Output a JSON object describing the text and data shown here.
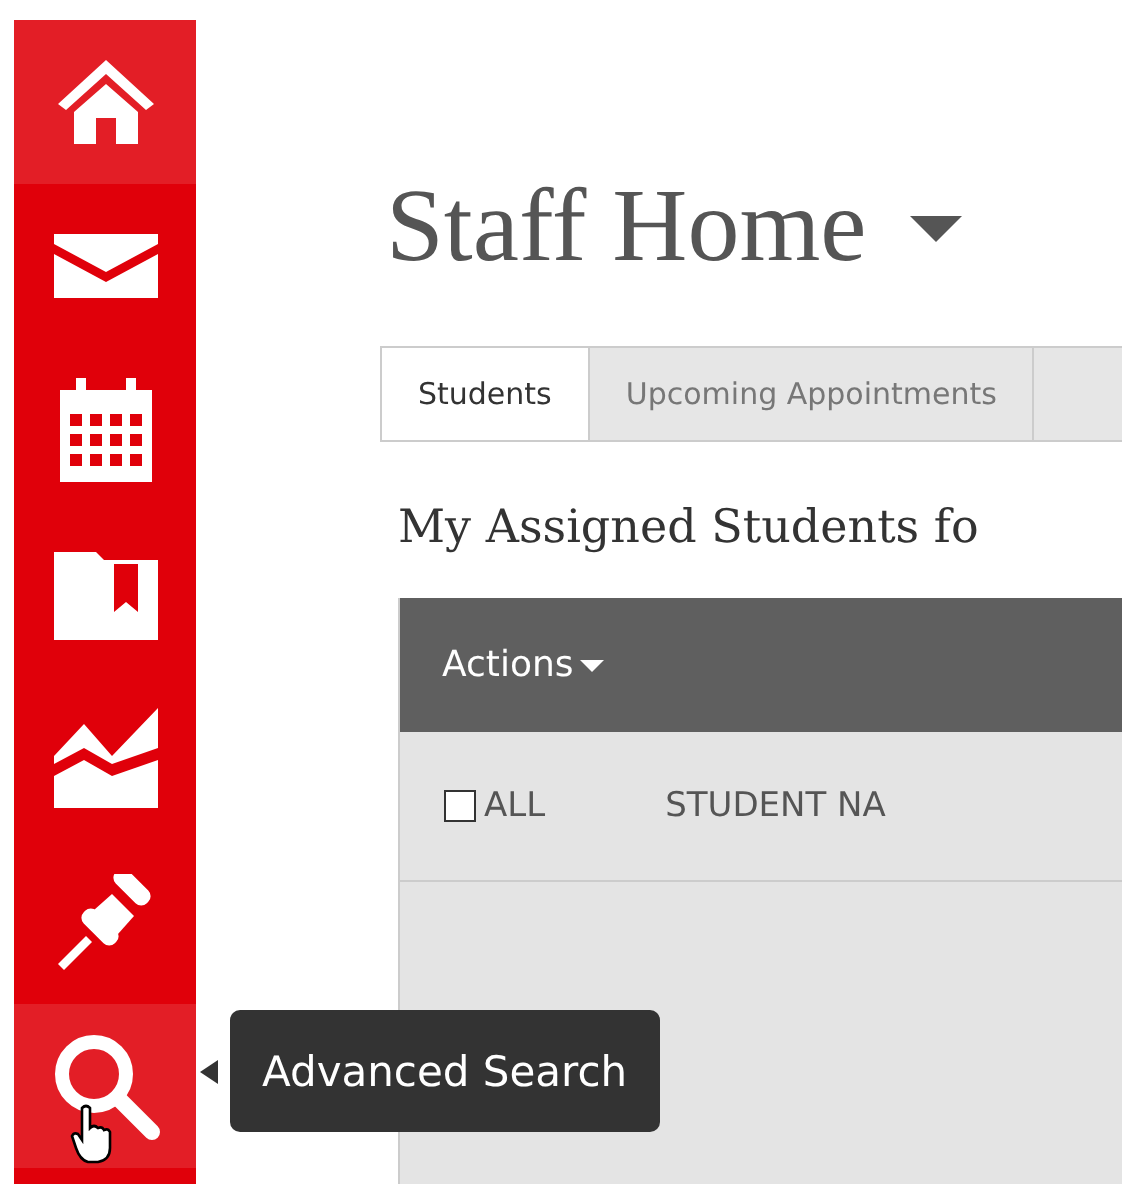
{
  "sidebar": {
    "items": [
      {
        "highlighted": true
      },
      {
        "highlighted": false
      },
      {
        "highlighted": false
      },
      {
        "highlighted": false
      },
      {
        "highlighted": false
      },
      {
        "highlighted": false
      },
      {
        "highlighted": true
      }
    ]
  },
  "tooltip": {
    "text": "Advanced Search"
  },
  "page": {
    "title": "Staff Home"
  },
  "tabs": [
    {
      "label": "Students",
      "selected": true
    },
    {
      "label": "Upcoming Appointments",
      "selected": false
    }
  ],
  "section": {
    "heading": "My Assigned Students fo"
  },
  "table": {
    "actions": "Actions",
    "select_all": {
      "label": "ALL",
      "checked": false
    },
    "columns": [
      "STUDENT NA"
    ]
  }
}
